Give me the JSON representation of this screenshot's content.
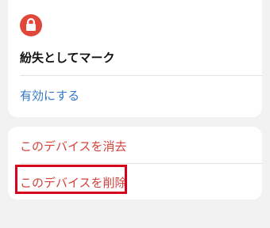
{
  "lost_mode": {
    "icon": "lock-icon",
    "icon_color": "#e0473a",
    "title": "紛失としてマーク",
    "enable_label": "有効にする"
  },
  "device_actions": {
    "erase_label": "このデバイスを消去",
    "remove_label": "このデバイスを削除"
  },
  "colors": {
    "link_blue": "#3478c6",
    "destructive_red": "#d5413a",
    "highlight_red": "#d6001c"
  }
}
